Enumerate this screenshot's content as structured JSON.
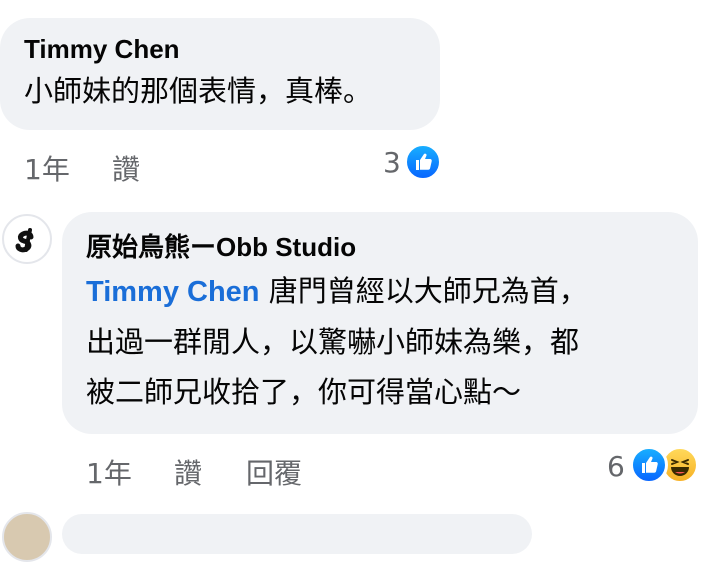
{
  "comment1": {
    "author": "Timmy  Chen",
    "text": "小師妹的那個表情，真棒。",
    "time": "1年",
    "like_label": "讚",
    "reaction_count": "3"
  },
  "reply1": {
    "author": "原始鳥熊ーObb Studio",
    "mention": "Timmy  Chen",
    "text_line1": " 唐門曾經以大師兄為首，",
    "text_line2": "出過一群閒人，以驚嚇小師妹為樂，都",
    "text_line3": "被二師兄收拾了，你可得當心點～",
    "time": "1年",
    "like_label": "讚",
    "reply_label": "回覆",
    "reaction_count": "6"
  },
  "colors": {
    "bubble": "#f0f2f5",
    "mention": "#1a6ed8",
    "meta": "#65676b",
    "like": "#0866ff"
  }
}
